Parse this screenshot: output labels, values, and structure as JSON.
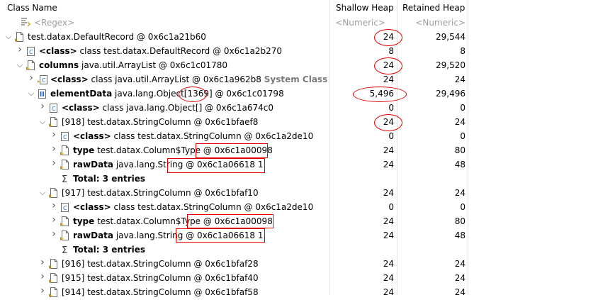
{
  "columns": {
    "class_name": "Class Name",
    "shallow_heap": "Shallow Heap",
    "retained_heap": "Retained Heap"
  },
  "filters": {
    "regex": "<Regex>",
    "numeric1": "<Numeric>",
    "numeric2": "<Numeric>"
  },
  "rows": [
    {
      "prefix": "",
      "rest": "test.datax.DefaultRecord @ 0x6c1a21b60",
      "shallow": "24",
      "retained": "29,544"
    },
    {
      "prefix": "<class>",
      "rest": " class test.datax.DefaultRecord @ 0x6c1a2b270",
      "shallow": "8",
      "retained": "8"
    },
    {
      "prefix": "columns",
      "rest": " java.util.ArrayList @ 0x6c1c01780",
      "shallow": "24",
      "retained": "29,520"
    },
    {
      "prefix": "<class>",
      "rest": " class java.util.ArrayList @ 0x6c1a962b8 ",
      "sys": "System Class",
      "shallow": "24",
      "retained": "24"
    },
    {
      "prefix": "elementData",
      "rest": " java.lang.Object[1369] @ 0x6c1c01798",
      "shallow": "5,496",
      "retained": "29,496"
    },
    {
      "prefix": "<class>",
      "rest": " class java.lang.Object[] @ 0x6c1a674c0",
      "shallow": "0",
      "retained": "0"
    },
    {
      "prefix": "",
      "rest": "[918] test.datax.StringColumn @ 0x6c1bfaef8",
      "shallow": "24",
      "retained": "24"
    },
    {
      "prefix": "<class>",
      "rest": " class test.datax.StringColumn @ 0x6c1a2de10",
      "shallow": "0",
      "retained": "0"
    },
    {
      "prefix": "type",
      "rest": " test.datax.Column$Type @ 0x6c1a00098",
      "shallow": "24",
      "retained": "80"
    },
    {
      "prefix": "rawData",
      "rest": " java.lang.String @ 0x6c1a06618  1",
      "shallow": "24",
      "retained": "48"
    },
    {
      "prefix": "Total: 3 entries",
      "rest": "",
      "shallow": "",
      "retained": ""
    },
    {
      "prefix": "",
      "rest": "[917] test.datax.StringColumn @ 0x6c1bfaf10",
      "shallow": "24",
      "retained": "24"
    },
    {
      "prefix": "<class>",
      "rest": " class test.datax.StringColumn @ 0x6c1a2de10",
      "shallow": "0",
      "retained": "0"
    },
    {
      "prefix": "type",
      "rest": " test.datax.Column$Type @ 0x6c1a00098",
      "shallow": "24",
      "retained": "80"
    },
    {
      "prefix": "rawData",
      "rest": " java.lang.String @ 0x6c1a06618  1",
      "shallow": "24",
      "retained": "48"
    },
    {
      "prefix": "Total: 3 entries",
      "rest": "",
      "shallow": "",
      "retained": ""
    },
    {
      "prefix": "",
      "rest": "[916] test.datax.StringColumn @ 0x6c1bfaf28",
      "shallow": "24",
      "retained": "24"
    },
    {
      "prefix": "",
      "rest": "[915] test.datax.StringColumn @ 0x6c1bfaf40",
      "shallow": "24",
      "retained": "24"
    },
    {
      "prefix": "",
      "rest": "[914] test.datax.StringColumn @ 0x6c1bfaf58",
      "shallow": "24",
      "retained": "24"
    }
  ],
  "colors": {
    "annotation": "#e00000",
    "class_icon": "#3a7bd5",
    "system_class": "#7a7a7a"
  }
}
